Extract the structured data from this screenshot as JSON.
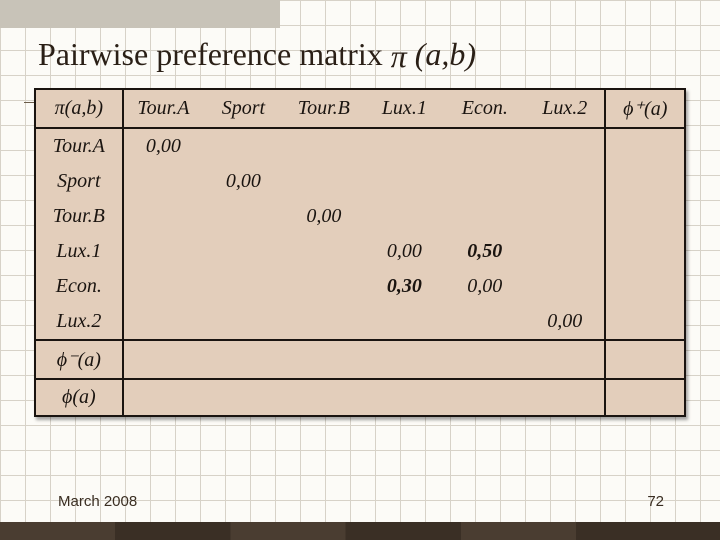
{
  "title_prefix": "Pairwise preference matrix ",
  "title_symbol": "π",
  "title_args": "(a,b)",
  "footer_date": "March 2008",
  "footer_page": "72",
  "header": {
    "corner": "π(a,b)",
    "cols": [
      "Tour.A",
      "Sport",
      "Tour.B",
      "Lux.1",
      "Econ.",
      "Lux.2"
    ],
    "phi_plus": "ϕ⁺(a)"
  },
  "rows": [
    "Tour.A",
    "Sport",
    "Tour.B",
    "Lux.1",
    "Econ.",
    "Lux.2"
  ],
  "footer_rows": [
    "ϕ⁻(a)",
    "ϕ(a)"
  ],
  "cells": {
    "Tour.A": {
      "Tour.A": "0,00"
    },
    "Sport": {
      "Sport": "0,00"
    },
    "Tour.B": {
      "Tour.B": "0,00"
    },
    "Lux.1": {
      "Lux.1": "0,00",
      "Econ.": "0,50"
    },
    "Econ.": {
      "Lux.1": "0,30",
      "Econ.": "0,00"
    },
    "Lux.2": {
      "Lux.2": "0,00"
    }
  },
  "highlights": [
    "Lux.1|Econ.",
    "Econ.|Lux.1"
  ],
  "chart_data": {
    "type": "table",
    "title": "Pairwise preference matrix π(a,b)",
    "row_labels": [
      "Tour.A",
      "Sport",
      "Tour.B",
      "Lux.1",
      "Econ.",
      "Lux.2"
    ],
    "col_labels": [
      "Tour.A",
      "Sport",
      "Tour.B",
      "Lux.1",
      "Econ.",
      "Lux.2"
    ],
    "values": [
      [
        0.0,
        null,
        null,
        null,
        null,
        null
      ],
      [
        null,
        0.0,
        null,
        null,
        null,
        null
      ],
      [
        null,
        null,
        0.0,
        null,
        null,
        null
      ],
      [
        null,
        null,
        null,
        0.0,
        0.5,
        null
      ],
      [
        null,
        null,
        null,
        0.3,
        0.0,
        null
      ],
      [
        null,
        null,
        null,
        null,
        null,
        0.0
      ]
    ],
    "extra_summary_rows": [
      "ϕ⁻(a)",
      "ϕ(a)"
    ],
    "extra_summary_col": "ϕ⁺(a)"
  }
}
